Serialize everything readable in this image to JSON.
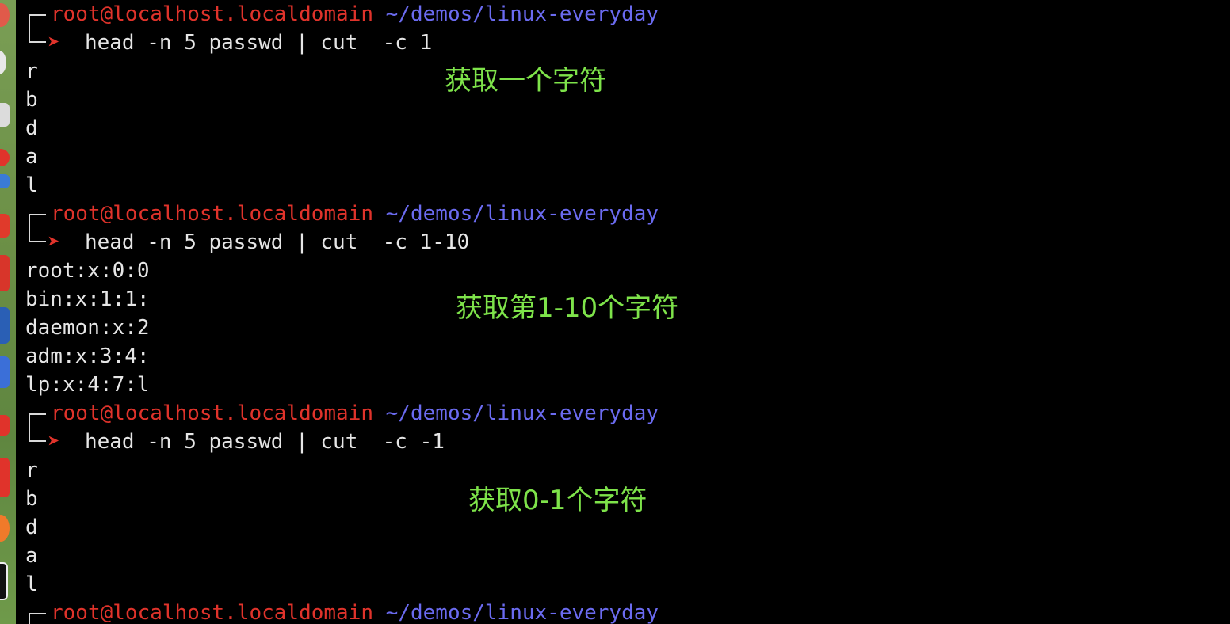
{
  "colors": {
    "background": "#000000",
    "prompt_user_host": "#e0332b",
    "prompt_path": "#6b6bf0",
    "text": "#e6e6e6",
    "note": "#7ee34a",
    "arrow": "#e0332b"
  },
  "prompt": {
    "user": "root",
    "at": "@",
    "host": "localhost.localdomain",
    "path": "~/demos/linux-everyday",
    "arrow": "➤"
  },
  "blocks": [
    {
      "command": "head -n 5 passwd | cut  -c 1",
      "output": [
        "r",
        "b",
        "d",
        "a",
        "l"
      ],
      "note": "获取一个字符"
    },
    {
      "command": "head -n 5 passwd | cut  -c 1-10",
      "output": [
        "root:x:0:0",
        "bin:x:1:1:",
        "daemon:x:2",
        "adm:x:3:4:",
        "lp:x:4:7:l"
      ],
      "note": "获取第1-10个字符"
    },
    {
      "command": "head -n 5 passwd | cut  -c -1",
      "output": [
        "r",
        "b",
        "d",
        "a",
        "l"
      ],
      "note": "获取0-1个字符"
    }
  ]
}
